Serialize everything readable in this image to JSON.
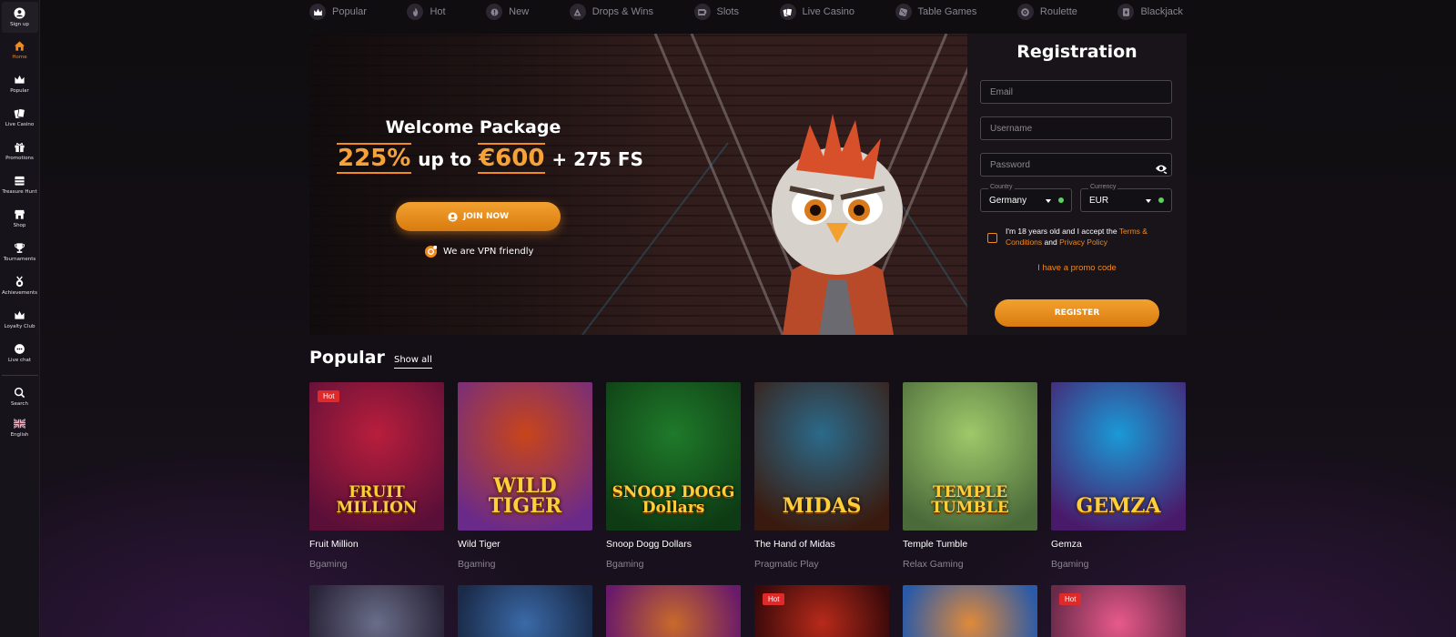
{
  "sidebar": {
    "signup_label": "Sign up",
    "items": [
      {
        "label": "Home",
        "icon": "home-icon",
        "active": true
      },
      {
        "label": "Popular",
        "icon": "crown-icon"
      },
      {
        "label": "Live Casino",
        "icon": "cards-icon"
      },
      {
        "label": "Promotions",
        "icon": "gift-icon"
      },
      {
        "label": "Treasure Hunt",
        "icon": "chest-icon"
      },
      {
        "label": "Shop",
        "icon": "shop-icon"
      },
      {
        "label": "Tournaments",
        "icon": "trophy-icon"
      },
      {
        "label": "Achievements",
        "icon": "medal-icon"
      },
      {
        "label": "Loyalty Club",
        "icon": "crown-icon"
      },
      {
        "label": "Live chat",
        "icon": "chat-icon"
      }
    ],
    "search_label": "Search",
    "language_label": "English"
  },
  "topnav": [
    {
      "label": "Popular",
      "icon": "crown-icon"
    },
    {
      "label": "Hot",
      "icon": "flame-icon"
    },
    {
      "label": "New",
      "icon": "new-icon"
    },
    {
      "label": "Drops & Wins",
      "icon": "drops-icon"
    },
    {
      "label": "Slots",
      "icon": "slot-icon"
    },
    {
      "label": "Live Casino",
      "icon": "cards-icon"
    },
    {
      "label": "Table Games",
      "icon": "dice-icon"
    },
    {
      "label": "Roulette",
      "icon": "roulette-icon"
    },
    {
      "label": "Blackjack",
      "icon": "blackjack-icon"
    }
  ],
  "hero": {
    "title": "Welcome Package",
    "offer_percent": "225%",
    "offer_mid": " up to ",
    "offer_amount": "€600",
    "offer_extra": " + 275 FS",
    "join_label": "JOIN NOW",
    "vpn_text": "We are VPN friendly"
  },
  "registration": {
    "title": "Registration",
    "email_placeholder": "Email",
    "username_placeholder": "Username",
    "password_placeholder": "Password",
    "country_legend": "Country",
    "country_value": "Germany",
    "currency_legend": "Currency",
    "currency_value": "EUR",
    "terms_prefix": "I'm 18 years old and I accept the ",
    "terms_link": "Terms & Conditions",
    "terms_and": " and ",
    "privacy_link": "Privacy Policy",
    "promo_label": "I have a promo code",
    "register_label": "REGISTER"
  },
  "popular": {
    "title": "Popular",
    "show_all": "Show all",
    "badge_hot": "Hot",
    "games": [
      {
        "name": "Fruit Million",
        "provider": "Bgaming",
        "art_text": "FRUIT MILLION",
        "hot": true,
        "colors": [
          "#b91e3c",
          "#5a0f38"
        ]
      },
      {
        "name": "Wild Tiger",
        "provider": "Bgaming",
        "art_text": "WILD TIGER",
        "hot": false,
        "colors": [
          "#c8451a",
          "#6a2a8a"
        ]
      },
      {
        "name": "Snoop Dogg Dollars",
        "provider": "Bgaming",
        "art_text": "SNOOP DOGG Dollars",
        "hot": false,
        "colors": [
          "#1f7a2a",
          "#0e3a14"
        ]
      },
      {
        "name": "The Hand of Midas",
        "provider": "Pragmatic Play",
        "art_text": "MIDAS",
        "hot": false,
        "colors": [
          "#2b6a8a",
          "#3a1a0e"
        ]
      },
      {
        "name": "Temple Tumble",
        "provider": "Relax Gaming",
        "art_text": "TEMPLE TUMBLE",
        "hot": false,
        "colors": [
          "#9fc86a",
          "#4a6a3a"
        ]
      },
      {
        "name": "Gemza",
        "provider": "Bgaming",
        "art_text": "GEMZA",
        "hot": false,
        "colors": [
          "#1a9ad6",
          "#4a1a6a"
        ]
      }
    ],
    "row2": [
      {
        "hot": false,
        "colors": [
          "#6a6e8a",
          "#2a2438"
        ]
      },
      {
        "hot": false,
        "colors": [
          "#3a6aa8",
          "#1a2a48"
        ]
      },
      {
        "hot": false,
        "colors": [
          "#c86a2a",
          "#6a1a6a"
        ]
      },
      {
        "hot": true,
        "colors": [
          "#b82a1a",
          "#3a0a0a"
        ]
      },
      {
        "hot": false,
        "colors": [
          "#e08a3a",
          "#2a5aa8"
        ]
      },
      {
        "hot": true,
        "colors": [
          "#e85a8a",
          "#6a2a4a"
        ]
      }
    ]
  },
  "colors": {
    "accent": "#f28a1e",
    "background": "#0f0c0f",
    "hot_badge": "#e02a2a"
  }
}
